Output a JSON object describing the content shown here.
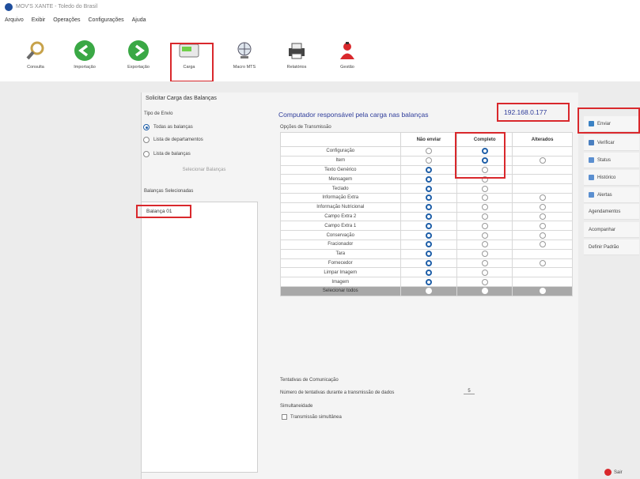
{
  "window": {
    "title": "MOV'S XANTE - Toledo do Brasil"
  },
  "menu": [
    "Arquivo",
    "Exibir",
    "Operações",
    "Configurações",
    "Ajuda"
  ],
  "toolbar": [
    {
      "label": "Consulta",
      "icon": "magnifier-icon"
    },
    {
      "label": "Importação",
      "icon": "green-arrow-left-icon"
    },
    {
      "label": "Exportação",
      "icon": "green-arrow-right-icon"
    },
    {
      "label": "Carga",
      "icon": "scale-display-icon"
    },
    {
      "label": "Macro MTS",
      "icon": "globe-icon"
    },
    {
      "label": "Relatórios",
      "icon": "printer-icon"
    },
    {
      "label": "Gestão",
      "icon": "red-person-icon"
    }
  ],
  "dialog": {
    "title": "Solicitar Carga das Balanças",
    "tipo_envio_label": "Tipo de Envio",
    "radios": [
      "Todas as balanças",
      "Lista de departamentos",
      "Lista de balanças"
    ],
    "selected_radio": 0,
    "selecionar_btn": "Selecionar Balanças",
    "balancas_label": "Balanças Selecionadas",
    "balancas": [
      "Balança 01"
    ],
    "computer_text": "Computador responsável pela carga nas balanças",
    "ip": "192.168.0.177",
    "opcoes_label": "Opções de Transmissão",
    "headers": [
      "Não enviar",
      "Completo",
      "Alterados"
    ],
    "rows": [
      {
        "label": "Configuração",
        "sel": 1,
        "alt": false
      },
      {
        "label": "Item",
        "sel": 1,
        "alt": true
      },
      {
        "label": "Texto Genérico",
        "sel": 0,
        "alt": false
      },
      {
        "label": "Mensagem",
        "sel": 0,
        "alt": false
      },
      {
        "label": "Teclado",
        "sel": 0,
        "alt": false
      },
      {
        "label": "Informação Extra",
        "sel": 0,
        "alt": true
      },
      {
        "label": "Informação Nutricional",
        "sel": 0,
        "alt": true
      },
      {
        "label": "Campo Extra 2",
        "sel": 0,
        "alt": true
      },
      {
        "label": "Campo Extra 1",
        "sel": 0,
        "alt": true
      },
      {
        "label": "Conservação",
        "sel": 0,
        "alt": true
      },
      {
        "label": "Fracionador",
        "sel": 0,
        "alt": true
      },
      {
        "label": "Tara",
        "sel": 0,
        "alt": false
      },
      {
        "label": "Fornecedor",
        "sel": 0,
        "alt": true
      },
      {
        "label": "Limpar Imagem",
        "sel": 0,
        "alt": false
      },
      {
        "label": "Imagem",
        "sel": 0,
        "alt": false
      }
    ],
    "select_all": "Selecionar todos",
    "tentativas_label": "Tentativas de Comunicação",
    "tentativas_text": "Número de tentativas durante a transmissão de dados",
    "tentativas_value": "5",
    "simult_label": "Simultaneidade",
    "simult_check": "Transmissão simultânea"
  },
  "side_buttons": [
    {
      "label": "Enviar",
      "icon": "send-icon",
      "color": "#3b82c4"
    },
    {
      "label": "Verificar",
      "icon": "verify-icon",
      "color": "#4a7fc0"
    },
    {
      "label": "Status",
      "icon": "status-icon",
      "color": "#5b8fd0"
    },
    {
      "label": "Histórico",
      "icon": "history-icon",
      "color": "#5b8fd0"
    },
    {
      "label": "Alertas",
      "icon": "alert-icon",
      "color": "#5b8fd0"
    },
    {
      "label": "Agendamentos",
      "icon": "",
      "color": ""
    },
    {
      "label": "Acompanhar",
      "icon": "",
      "color": ""
    },
    {
      "label": "Definir Padrão",
      "icon": "",
      "color": ""
    }
  ],
  "sair": "Sair",
  "colors": {
    "accent": "#1f5fa8",
    "highlight": "#d9282c",
    "ip_text": "#2e3c9a"
  }
}
